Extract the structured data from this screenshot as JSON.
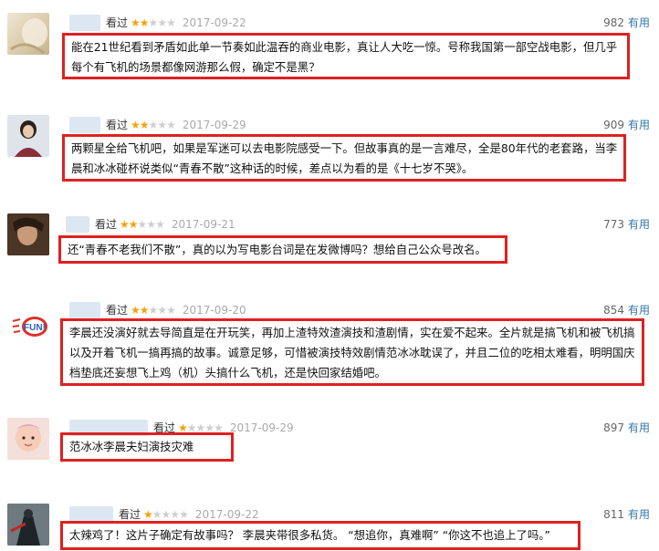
{
  "comments": [
    {
      "seen_label": "看过",
      "rating": 2,
      "date": "2017-09-22",
      "votes": "982",
      "useful_label": "有用",
      "text": "能在21世纪看到矛盾如此单一节奏如此温吞的商业电影，真让人大吃一惊。号称我国第一部空战电影，但几乎每个有飞机的场景都像网游那么假，确定不是黑？",
      "avatar": "beige-avatar"
    },
    {
      "seen_label": "看过",
      "rating": 2,
      "date": "2017-09-29",
      "votes": "909",
      "useful_label": "有用",
      "text": "两颗星全给飞机吧，如果是军迷可以去电影院感受一下。但故事真的是一言难尽，全是80年代的老套路，当李晨和冰冰碰杯说类似“青春不散”这种话的时候，差点以为看的是《十七岁不哭》。",
      "avatar": "woman-photo-avatar"
    },
    {
      "seen_label": "看过",
      "rating": 2,
      "date": "2017-09-21",
      "votes": "773",
      "useful_label": "有用",
      "text": "还“青春不老我们不散”，真的以为写电影台词是在发微博吗？想给自己公众号改名。",
      "avatar": "dark-photo-avatar"
    },
    {
      "seen_label": "看过",
      "rating": 2,
      "date": "2017-09-20",
      "votes": "854",
      "useful_label": "有用",
      "text": "李晨还没演好就去导简直是在开玩笑，再加上渣特效渣演技和渣剧情，实在爱不起来。全片就是搞飞机和被飞机搞以及开着飞机一搞再搞的故事。诚意足够，可惜被演技特效剧情范冰冰耽误了，并且二位的吃相太难看，明明国庆档垫底还妄想飞上鸡（机）头搞什么飞机，还是快回家结婚吧。",
      "avatar": "fun-logo-avatar",
      "avatar_text": "FUN!"
    },
    {
      "seen_label": "看过",
      "rating": 1,
      "date": "2017-09-29",
      "votes": "897",
      "useful_label": "有用",
      "text": "范冰冰李晨夫妇演技灾难",
      "avatar": "baby-photo-avatar"
    },
    {
      "seen_label": "看过",
      "rating": 1,
      "date": "2017-09-22",
      "votes": "811",
      "useful_label": "有用",
      "text": "太辣鸡了！这片子确定有故事吗？ 李晨夹带很多私货。 “想追你，真难啊” “你这不也追上了吗。”",
      "avatar": "figure-photo-avatar"
    }
  ],
  "colors": {
    "highlight_border": "#e02020",
    "star_on": "#f2a20c",
    "star_off": "#cfcfcf",
    "link": "#3377aa"
  }
}
